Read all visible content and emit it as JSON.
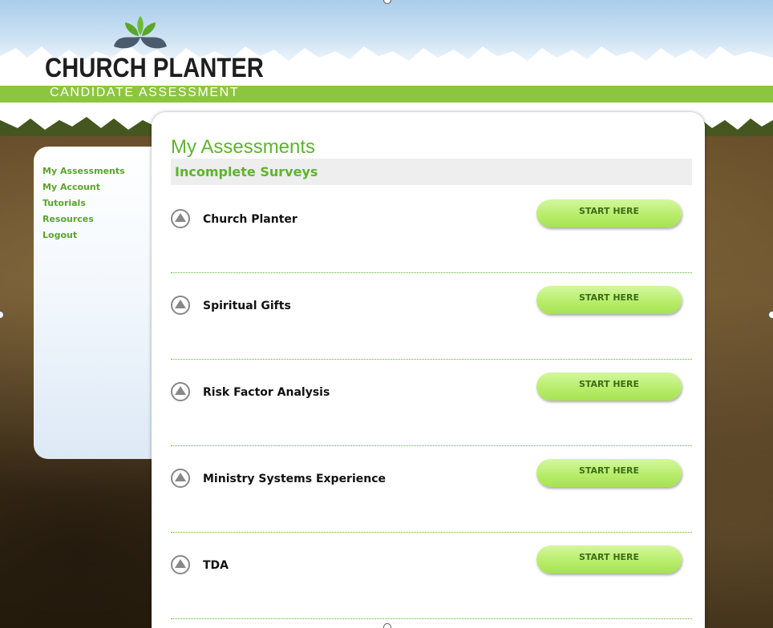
{
  "logo": {
    "title": "CHURCH PLANTER",
    "subtitle": "CANDIDATE ASSESSMENT",
    "icon": "leaf-logo-icon"
  },
  "sidebar": {
    "items": [
      {
        "label": "My Assessments"
      },
      {
        "label": "My Account"
      },
      {
        "label": "Tutorials"
      },
      {
        "label": "Resources"
      },
      {
        "label": "Logout"
      }
    ]
  },
  "main": {
    "title": "My Assessments",
    "section_title": "Incomplete Surveys",
    "surveys": [
      {
        "name": "Church Planter",
        "button": "START HERE",
        "icon": "expand-arrow-icon"
      },
      {
        "name": "Spiritual Gifts",
        "button": "START HERE",
        "icon": "expand-arrow-icon"
      },
      {
        "name": "Risk Factor Analysis",
        "button": "START HERE",
        "icon": "expand-arrow-icon"
      },
      {
        "name": "Ministry Systems Experience",
        "button": "START HERE",
        "icon": "expand-arrow-icon"
      },
      {
        "name": "TDA",
        "button": "START HERE",
        "icon": "expand-arrow-icon"
      }
    ]
  },
  "colors": {
    "accent_green": "#5eb42d",
    "band_green": "#8cc63f",
    "button_green": "#b9ed6c",
    "sky_blue": "#a9cdeb"
  }
}
